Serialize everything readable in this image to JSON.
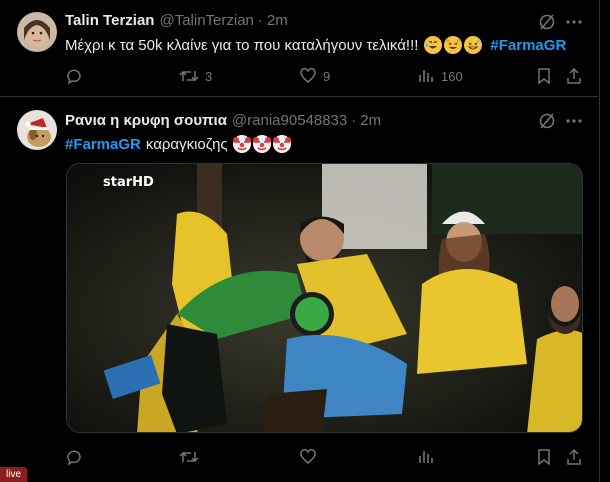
{
  "tweets": [
    {
      "name": "Talin Terzian",
      "handle": "@TalinTerzian",
      "time": "2m",
      "text": "Μέχρι κ τα 50k κλαίνε για το που καταλήγουν τελικά!!!",
      "emojis": [
        "rolling-on-floor-laughing",
        "grinning-squinting-cat",
        "grinning-with-sweat"
      ],
      "hashtag": "#FarmaGR",
      "stats": {
        "replies": "",
        "retweets": "3",
        "likes": "9",
        "views": "160"
      }
    },
    {
      "name": "Ρανια η κρυφη σουπια",
      "handle": "@rania90548833",
      "time": "2m",
      "hashtag": "#FarmaGR",
      "text": "καραγκιοζης",
      "emojis": [
        "clown-face",
        "clown-face",
        "clown-face"
      ],
      "media": {
        "watermark": "starHD"
      },
      "stats": {
        "replies": "",
        "retweets": "",
        "likes": "",
        "views": ""
      }
    }
  ],
  "overlay": {
    "live_label": "live"
  },
  "colors": {
    "accent": "#1d9bf0",
    "muted": "#71767b",
    "border": "#2f3336",
    "background": "#000000"
  },
  "icons": [
    "grok-icon",
    "more-icon",
    "reply-icon",
    "retweet-icon",
    "like-icon",
    "views-icon",
    "bookmark-icon",
    "share-icon"
  ]
}
